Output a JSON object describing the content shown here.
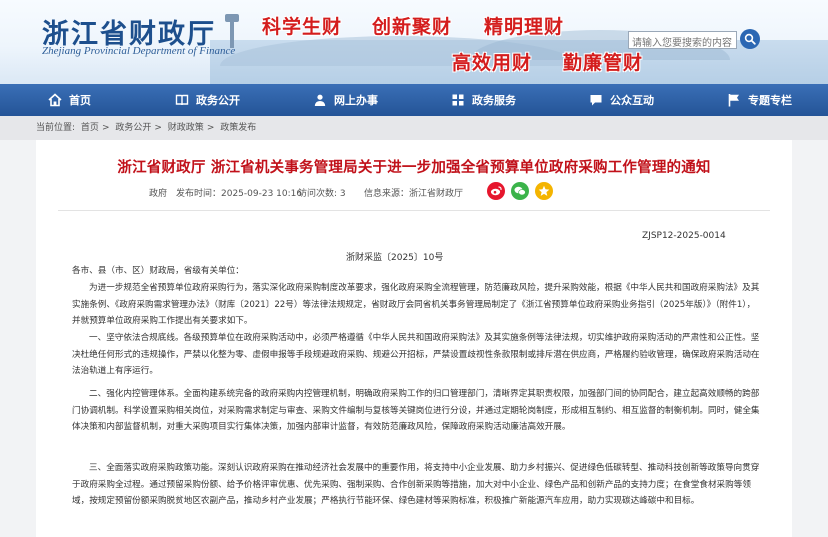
{
  "header": {
    "logo_cn": "浙江省财政厅",
    "logo_en": "Zhejiang Provincial Department of Finance",
    "slogans": [
      "科学生财",
      "创新聚财",
      "精明理财",
      "高效用财",
      "勤廉管财"
    ],
    "search_placeholder": "请输入您要搜索的内容"
  },
  "nav": {
    "items": [
      {
        "label": "首页",
        "icon": "home-icon"
      },
      {
        "label": "政务公开",
        "icon": "book-icon"
      },
      {
        "label": "网上办事",
        "icon": "person-icon"
      },
      {
        "label": "政务服务",
        "icon": "grid-icon"
      },
      {
        "label": "公众互动",
        "icon": "chat-icon"
      },
      {
        "label": "专题专栏",
        "icon": "flag-icon"
      }
    ]
  },
  "breadcrumb": {
    "prefix": "当前位置:",
    "items": [
      "首页",
      "政务公开",
      "财政政策",
      "政策发布"
    ]
  },
  "article": {
    "title": "浙江省财政厅 浙江省机关事务管理局关于进一步加强全省预算单位政府采购工作管理的通知",
    "publisher": "政府 ",
    "date": "发布时间：2025-09-23 10:16",
    "visits": "访问次数: 3",
    "source": "信息来源：浙江省财政厅",
    "doc_code": "ZJSP12-2025-0014",
    "wenhao": "浙财采监〔2025〕10号",
    "greeting": "各市、县（市、区）财政局，省级有关单位：",
    "paragraphs": [
      "为进一步规范全省预算单位政府采购行为，落实深化政府采购制度改革要求，强化政府采购全流程管理，防范廉政风险，提升采购效能，根据《中华人民共和国政府采购法》及其实施条例、《政府采购需求管理办法》（财库〔2021〕22号）等法律法规规定，省财政厅会同省机关事务管理局制定了《浙江省预算单位政府采购业务指引（2025年版）》（附件1），并就预算单位政府采购工作提出有关要求如下。",
      "一、坚守依法合规底线。各级预算单位在政府采购活动中，必须严格遵循《中华人民共和国政府采购法》及其实施条例等法律法规，切实维护政府采购活动的严肃性和公正性。坚决杜绝任何形式的违规操作，严禁以化整为零、虚假申报等手段规避政府采购、规避公开招标，严禁设置歧视性条款限制或排斥潜在供应商，严格履约验收管理，确保政府采购活动在法治轨道上有序运行。",
      "二、强化内控管理体系。全面构建系统完备的政府采购内控管理机制，明确政府采购工作的归口管理部门，清晰界定其职责权限，加强部门间的协同配合，建立起高效顺畅的跨部门协调机制。科学设置采购相关岗位，对采购需求制定与审查、采购文件编制与复核等关键岗位进行分设，并通过定期轮岗制度，形成相互制约、相互监督的制衡机制。同时，健全集体决策和内部监督机制，对重大采购项目实行集体决策，加强内部审计监督，有效防范廉政风险，保障政府采购活动廉洁高效开展。",
      "三、全面落实政府采购政策功能。深刻认识政府采购在推动经济社会发展中的重要作用，将支持中小企业发展、助力乡村振兴、促进绿色低碳转型、推动科技创新等政策导向贯穿于政府采购全过程。通过预留采购份额、给予价格评审优惠、优先采购、强制采购、合作创新采购等措施，加大对中小企业、绿色产品和创新产品的支持力度；在食堂食材采购等领域，按规定预留份额采购脱贫地区农副产品，推动乡村产业发展；严格执行节能环保、绿色建材等采购标准，积极推广新能源汽车应用，助力实现碳达峰碳中和目标。"
    ]
  }
}
